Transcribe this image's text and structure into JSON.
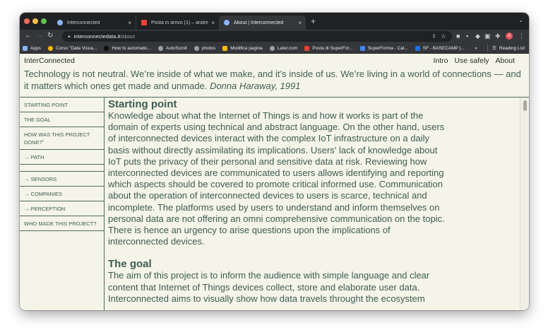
{
  "browser": {
    "tabs": [
      {
        "label": "Interconnected",
        "favicon_color": "#8ab4f8"
      },
      {
        "label": "Posta in arrivo (1) – andrea.eid...",
        "favicon_color": "#ea4335"
      },
      {
        "label": "About | Interconnected",
        "favicon_color": "#8ab4f8"
      }
    ],
    "new_tab": "+",
    "close_glyph": "×",
    "url_host": "interconnectedata.it",
    "url_path": "/about",
    "bookmarks": [
      {
        "label": "Apps",
        "color": "#8ab4f8"
      },
      {
        "label": "Corso \"Data Visua...",
        "color": "#fbbc04"
      },
      {
        "label": "How to automatic...",
        "color": "#202124"
      },
      {
        "label": "AutoScroll",
        "color": "#9aa0a6"
      },
      {
        "label": "photos",
        "color": "#9aa0a6"
      },
      {
        "label": "Modifica pagina",
        "color": "#fbbc04"
      },
      {
        "label": "Later.com",
        "color": "#9aa0a6"
      },
      {
        "label": "Posta di SuperFor...",
        "color": "#ea4335"
      },
      {
        "label": "SuperForma - Cal...",
        "color": "#4285f4"
      },
      {
        "label": "SF - BASECAMP |...",
        "color": "#1a73e8"
      }
    ],
    "bookmarks_more": "»",
    "reading_list": "Reading List",
    "avatar_letter": "A"
  },
  "site": {
    "brand": "InterConnected",
    "nav": [
      "Intro",
      "Use safely",
      "About"
    ],
    "quote": "Technology is not neutral. We’re inside of what we make, and it’s inside of us. We’re living in a world of connections — and it matters which ones get made and unmade.",
    "quote_author": "Donna Haraway, 1991"
  },
  "sidebar": {
    "items": [
      "STARTING POINT",
      "THE GOAL",
      "HOW WAS THIS PROJECT DONE? ⃗",
      "→ PATH",
      "",
      "→ SENSORS",
      "→ COMPANIES",
      "→ PERCEPTION",
      "WHO MADE THIS PROJECT?"
    ]
  },
  "content": {
    "section1_title": "Starting point",
    "section1_text": "Knowledge about what the Internet of Things is and how it works is part of the domain of experts using technical and abstract language. On the other hand, users of interconnected devices interact with the complex IoT infrastructure on a daily basis without directly assimilating its implications. Users' lack of knowledge about IoT puts the privacy of their personal and sensitive data at risk. Reviewing how interconnected devices are communicated to users allows identifying and reporting which aspects should be covered to promote critical informed use. Communication about the operation of interconnected devices to users is scarce, technical and incomplete. The platforms used by users to understand and inform themselves on personal data are not offering an omni comprehensive communication on the topic. There is hence an urgency to arise questions upon the implications of interconnected devices.",
    "section2_title": "The goal",
    "section2_text": "The aim of this project is to inform the audience with simple language and clear content that Internet of Things devices collect, store and elaborate user data. Interconnected aims to visually show how data travels throught the ecosystem"
  }
}
